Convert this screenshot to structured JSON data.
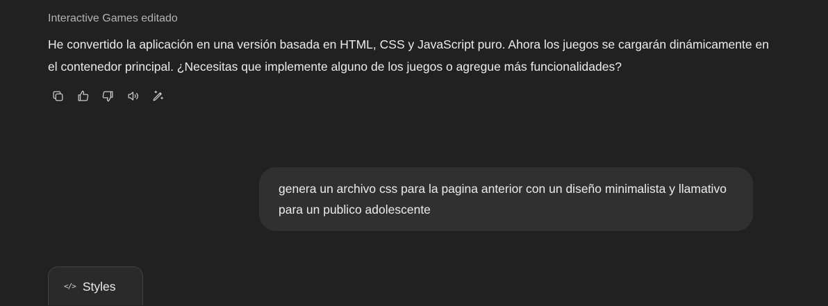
{
  "assistant": {
    "canvas_label": "Interactive Games editado",
    "message": "He convertido la aplicación en una versión basada en HTML, CSS y JavaScript puro. Ahora los juegos se cargarán dinámicamente en el contenedor principal. ¿Necesitas que implemente alguno de los juegos o agregue más funcionalidades?",
    "actions": [
      {
        "icon": "copy-icon"
      },
      {
        "icon": "thumbs-up-icon"
      },
      {
        "icon": "thumbs-down-icon"
      },
      {
        "icon": "read-aloud-icon"
      },
      {
        "icon": "edit-canvas-icon"
      }
    ]
  },
  "user": {
    "message": "genera un archivo css para la pagina anterior con un diseño minimalista y llamativo para un publico adolescente"
  },
  "canvas_chip": {
    "icon": "code-icon",
    "label": "Styles"
  },
  "colors": {
    "background": "#212121",
    "user_bubble": "#303030",
    "text": "#ececec",
    "muted_text": "#b4b4b4"
  }
}
